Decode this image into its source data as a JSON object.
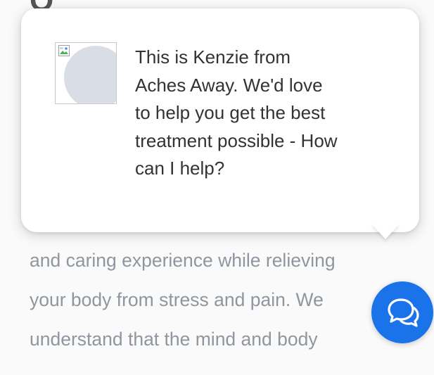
{
  "popup": {
    "avatar_alt": "",
    "message_lines": [
      "This is Kenzie from",
      "Aches Away. We'd love",
      "to help you get the best",
      "treatment possible - How",
      "can I help?"
    ]
  },
  "page": {
    "heading_fragment": "O",
    "body_lines": [
      "and caring experience while relieving",
      "your body from stress and pain. We",
      "understand that the mind and body",
      "..."
    ]
  },
  "chat_button": {
    "icon": "chat-bubbles-icon",
    "color": "#1a73e8"
  },
  "colors": {
    "body_text": "#6f7a86",
    "message_text": "#333333",
    "card_bg": "#ffffff"
  }
}
